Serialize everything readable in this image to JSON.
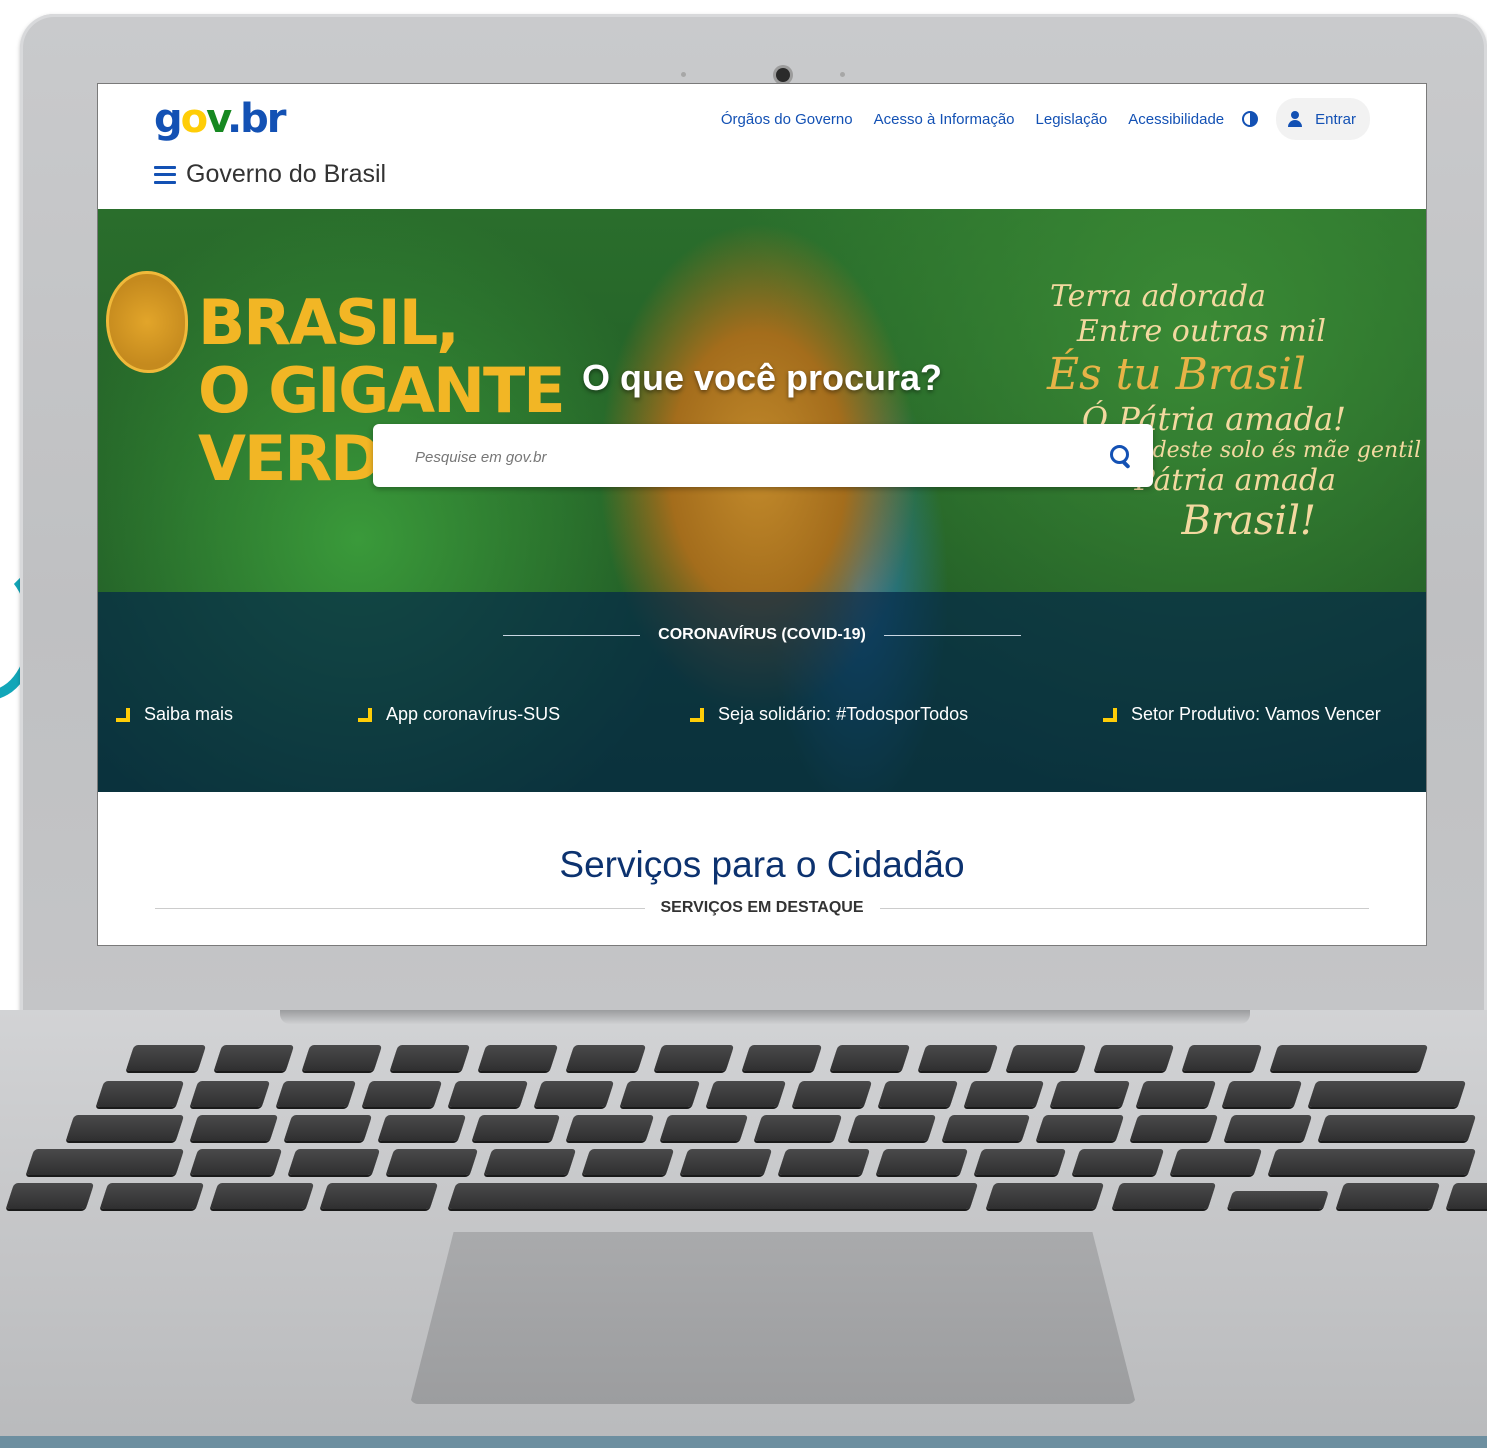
{
  "header": {
    "logo": {
      "g": "g",
      "o": "o",
      "v": "v",
      "br": ".br"
    },
    "site_title": "Governo do Brasil",
    "links": [
      "Órgãos do Governo",
      "Acesso à Informação",
      "Legislação",
      "Acessibilidade"
    ],
    "login_label": "Entrar"
  },
  "hero": {
    "art_text": [
      "BRASIL,",
      "O GIGANTE",
      "VERDE"
    ],
    "poem": [
      "Terra adorada",
      "Entre outras mil",
      "És tu Brasil",
      "Ó Pátria amada!",
      "Dos filhos deste solo és mãe gentil",
      "Pátria amada",
      "Brasil!"
    ],
    "question": "O que você procura?",
    "search_placeholder": "Pesquise em gov.br"
  },
  "covid": {
    "title": "CORONAVÍRUS (COVID-19)",
    "links": [
      "Saiba mais",
      "App coronavírus-SUS",
      "Seja solidário: #TodosporTodos",
      "Setor Produtivo: Vamos Vencer"
    ]
  },
  "services": {
    "title": "Serviços para o Cidadão",
    "subtitle": "SERVIÇOS EM DESTAQUE"
  },
  "colors": {
    "primary_blue": "#1351b4",
    "dark_blue": "#0c326f",
    "accent_yellow": "#ffcd07",
    "green": "#168821"
  }
}
